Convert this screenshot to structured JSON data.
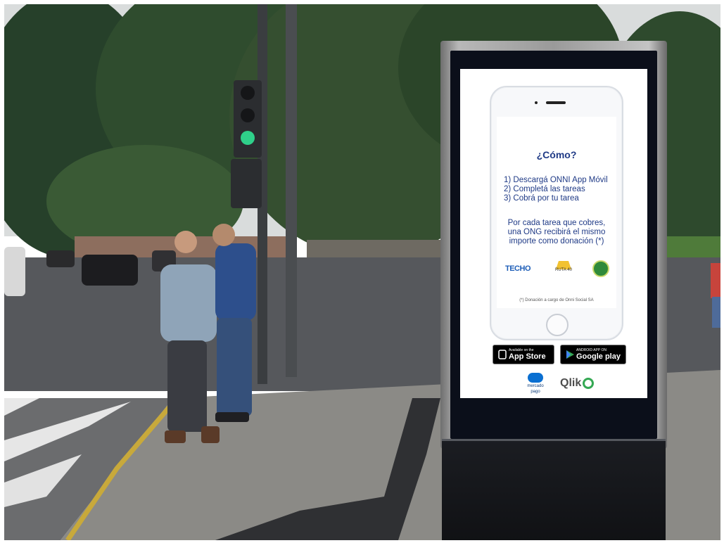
{
  "kiosk": {
    "heading": "¿Cómo?",
    "steps": [
      "1) Descargá ONNI App Móvil",
      "2) Completá las tareas",
      "3) Cobrá por tu tarea"
    ],
    "donation_line_1": "Por cada tarea que cobres,",
    "donation_line_2": "una ONG recibirá el mismo",
    "donation_line_3": "importe como donación (*)",
    "partners": {
      "techo": "TECHO",
      "ruta": "RUTA 40"
    },
    "footnote": "(*) Donación a cargo de Onni Social SA",
    "stores": {
      "apple_small": "Available on the",
      "apple_big": "App Store",
      "google_small": "ANDROID APP ON",
      "google_big": "Google play"
    },
    "sponsors": {
      "mercadopago_1": "mercado",
      "mercadopago_2": "pago",
      "qlik": "Qlik"
    }
  },
  "colors": {
    "screen_text": "#1f3a86",
    "qlik_green": "#34a853",
    "mercadopago_blue": "#0a6fd1"
  }
}
